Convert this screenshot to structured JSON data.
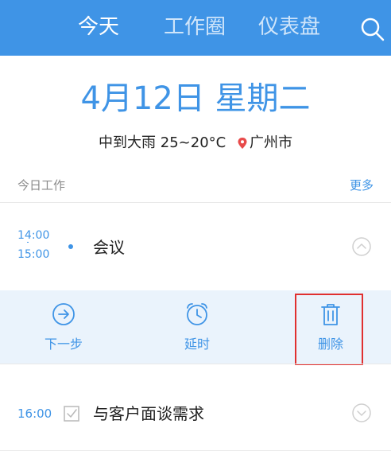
{
  "header": {
    "tabs": [
      {
        "label": "今天",
        "active": true
      },
      {
        "label": "工作圈",
        "active": false
      },
      {
        "label": "仪表盘",
        "active": false
      }
    ],
    "search_icon": "search-icon"
  },
  "today": {
    "date": "4月12日 星期二",
    "weather": "中到大雨 25~20°C",
    "location": "广州市"
  },
  "section": {
    "label": "今日工作",
    "more": "更多"
  },
  "tasks": [
    {
      "start": "14:00",
      "end": "15:00",
      "title": "会议",
      "expanded": true,
      "actions": [
        {
          "label": "下一步",
          "icon": "arrow-right-circle-icon"
        },
        {
          "label": "延时",
          "icon": "alarm-clock-icon"
        },
        {
          "label": "删除",
          "icon": "trash-icon"
        }
      ]
    },
    {
      "start": "16:00",
      "title": "与客户面谈需求",
      "expanded": false
    }
  ],
  "colors": {
    "accent": "#3f94e6",
    "header_bg": "#3f94e6",
    "action_bg": "#eaf3fc",
    "highlight": "#e03030"
  }
}
